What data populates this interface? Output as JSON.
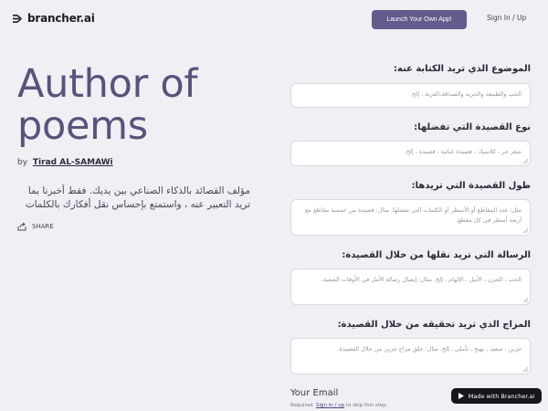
{
  "header": {
    "brand": "brancher.ai",
    "launch_button": "Launch Your Own App!",
    "signin_link": "Sign In / Up"
  },
  "hero": {
    "title": "Author of poems",
    "by_prefix": "by",
    "author": "Tirad AL-SAMAWi",
    "description": "مؤلف القصائد بالذكاء الصناعي بين يديك. فقط أخبرنا بما تريد التعبير عنه ، واستمتع بإحساس نقل أفكارك بالكلمات",
    "share_label": "SHARE"
  },
  "form": {
    "fields": [
      {
        "label": "الموضوع الذي تريد الكتابة عنه:",
        "placeholder": "الحب والطبيعة والحرية والصداقة،الغربة ، إلخ."
      },
      {
        "label": "نوع القصيدة التي تفضلها:",
        "placeholder": "شعر حر ، كلاسيك ، قصيدة غنائية ، قصيدة ، إلخ."
      },
      {
        "label": "طول القصيدة التي تريدها:",
        "placeholder": "مثل: عدد المقاطع أو الأسطر أو الكلمات التي تفضلها. مثال: قصيدة من خمسة مقاطع مع أربعة أسطر في كل مقطع."
      },
      {
        "label": "الرسالة التي تريد نقلها من خلال القصيدة:",
        "placeholder": "الحب ، الحزن ، الأمل ، الإلهام ، إلخ. مثال: إيصال رسالة الأمل في الأوقات الصعبة."
      },
      {
        "label": "المزاج الذي تريد تحقيقه من خلال القصيدة:",
        "placeholder": "حزين ، سعيد ، بهيج ، تأملي ، إلخ. مثال: خلق مزاج حزين من خلال القصيدة."
      }
    ],
    "email_label": "Your Email",
    "email_note_prefix": "Required.",
    "email_note_link": "Sign in / up",
    "email_note_suffix": "to skip this step."
  },
  "badge": {
    "label": "Made with Brancher.ai"
  },
  "colors": {
    "background": "#f1eef4",
    "accent": "#645a8c",
    "title": "#5a5279",
    "badge_bg": "#16161c"
  },
  "icons": [
    "brancher-logo-icon",
    "share-icon",
    "play-icon",
    "resize-grip-icon"
  ]
}
